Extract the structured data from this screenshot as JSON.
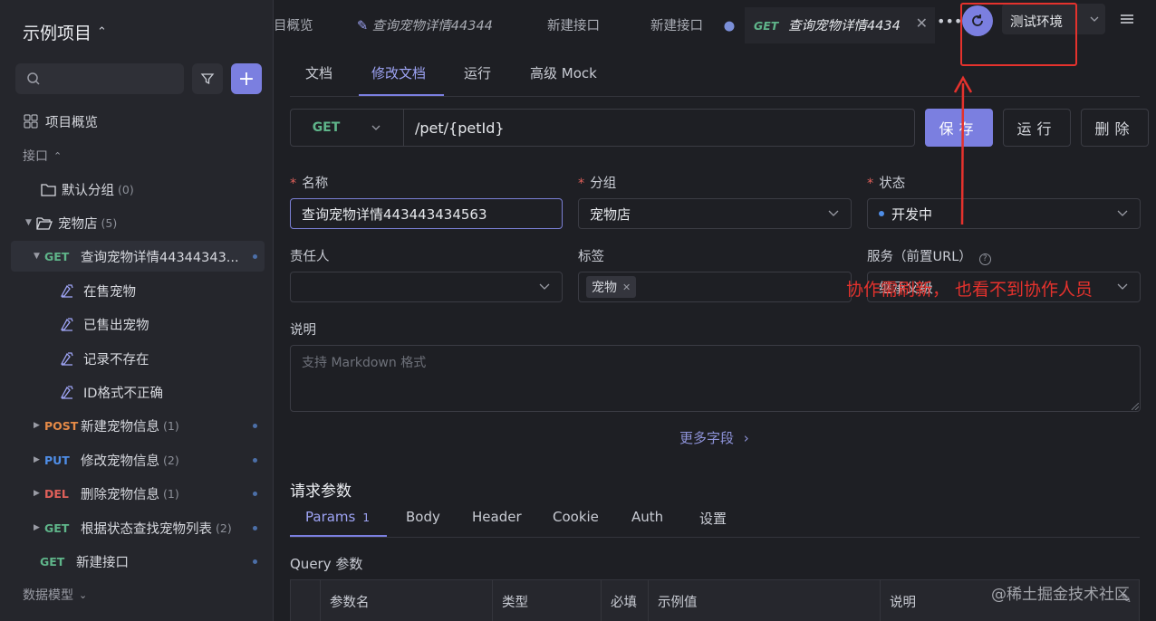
{
  "sidebar": {
    "project_title": "示例项目",
    "tree": {
      "overview": "项目概览",
      "api_section": "接口",
      "default_group": {
        "label": "默认分组",
        "count": "(0)"
      },
      "pet_store": {
        "label": "宠物店",
        "count": "(5)"
      },
      "active_api": {
        "method": "GET",
        "label": "查询宠物详情44344343..."
      },
      "cases": [
        "在售宠物",
        "已售出宠物",
        "记录不存在",
        "ID格式不正确"
      ],
      "apis": [
        {
          "method": "POST",
          "label": "新建宠物信息",
          "count": "(1)"
        },
        {
          "method": "PUT",
          "label": "修改宠物信息",
          "count": "(2)"
        },
        {
          "method": "DEL",
          "label": "删除宠物信息",
          "count": "(1)"
        },
        {
          "method": "GET",
          "label": "根据状态查找宠物列表",
          "count": "(2)"
        }
      ],
      "new_api": {
        "method": "GET",
        "label": "新建接口"
      },
      "data_model": "数据模型"
    }
  },
  "tabs": [
    {
      "label": "目概览"
    },
    {
      "label": "查询宠物详情44344"
    },
    {
      "label": "新建接口"
    },
    {
      "label": "新建接口"
    },
    {
      "method": "GET",
      "label": "查询宠物详情4434"
    }
  ],
  "env": {
    "label": "测试环境"
  },
  "subtabs": [
    "文档",
    "修改文档",
    "运行",
    "高级 Mock"
  ],
  "request": {
    "method": "GET",
    "url": "/pet/{petId}"
  },
  "buttons": {
    "save": "保存",
    "run": "运行",
    "delete": "删除"
  },
  "form": {
    "name": {
      "label": "名称",
      "value": "查询宠物详情443443434563"
    },
    "group": {
      "label": "分组",
      "value": "宠物店"
    },
    "status": {
      "label": "状态",
      "value": "开发中"
    },
    "owner": {
      "label": "责任人",
      "value": ""
    },
    "tags": {
      "label": "标签",
      "value": "宠物"
    },
    "service": {
      "label": "服务（前置URL）",
      "value": "继承父级"
    },
    "desc": {
      "label": "说明",
      "placeholder": "支持 Markdown 格式"
    },
    "more_fields": "更多字段"
  },
  "params": {
    "title": "请求参数",
    "tabs": [
      {
        "label": "Params",
        "badge": "1"
      },
      {
        "label": "Body"
      },
      {
        "label": "Header"
      },
      {
        "label": "Cookie"
      },
      {
        "label": "Auth"
      },
      {
        "label": "设置"
      }
    ],
    "query_label": "Query 参数",
    "columns": [
      "参数名",
      "类型",
      "必填",
      "示例值",
      "说明"
    ]
  },
  "annotation": {
    "text": "协作需刷新， 也看不到协作人员",
    "color": "#e5322d"
  },
  "watermark": "@稀土掘金技术社区",
  "colors": {
    "accent": "#7b7fe0",
    "get": "#5fb58a",
    "post": "#e58a47",
    "put": "#4f8ee8",
    "delete": "#e0605a"
  }
}
